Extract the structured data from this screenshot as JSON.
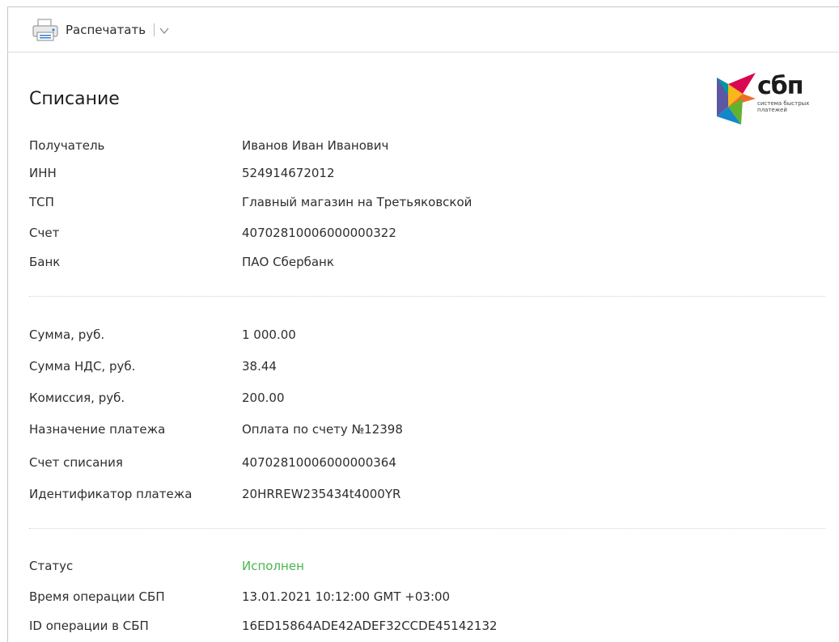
{
  "toolbar": {
    "print_label": "Распечатать"
  },
  "title": "Списание",
  "logo": {
    "word": "сбп",
    "sub": "система быстрых платежей"
  },
  "recipient_section": [
    {
      "label": "Получатель",
      "value": "Иванов Иван Иванович"
    },
    {
      "label": "ИНН",
      "value": "524914672012"
    },
    {
      "label": "ТСП",
      "value": "Главный магазин на Третьяковской"
    },
    {
      "label": "Счет",
      "value": "40702810006000000322"
    },
    {
      "label": "Банк",
      "value": "ПАО Сбербанк"
    }
  ],
  "payment_section": [
    {
      "label": "Сумма, руб.",
      "value": "1 000.00"
    },
    {
      "label": "Сумма НДС, руб.",
      "value": "38.44"
    },
    {
      "label": "Комиссия, руб.",
      "value": "200.00"
    },
    {
      "label": "Назначение платежа",
      "value": "Оплата по счету №12398"
    },
    {
      "label": "Счет списания",
      "value": "40702810006000000364"
    },
    {
      "label": "Идентификатор платежа",
      "value": "20HRREW235434t4000YR"
    }
  ],
  "status_section": [
    {
      "label": "Статус",
      "value": "Исполнен"
    },
    {
      "label": "Время операции СБП",
      "value": "13.01.2021 10:12:00 GMT +03:00"
    },
    {
      "label": "ID операции в СБП",
      "value": "16ED15864ADE42ADEF32CCDE45142132"
    }
  ],
  "colors": {
    "status_ok": "#49b64d",
    "icon_blue": "#2d7fd3"
  }
}
